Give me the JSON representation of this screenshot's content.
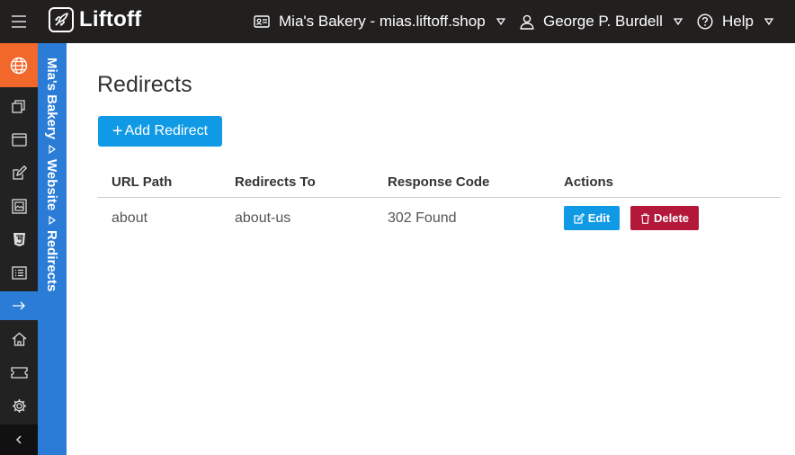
{
  "app": {
    "name": "Liftoff"
  },
  "topbar": {
    "site_label": "Mia's Bakery - mias.liftoff.shop",
    "user_label": "George P. Burdell",
    "help_label": "Help"
  },
  "rail": {
    "items": [
      {
        "icon": "globe-icon",
        "active": true
      },
      {
        "icon": "pages-icon"
      },
      {
        "icon": "window-icon"
      },
      {
        "icon": "edit-icon"
      },
      {
        "icon": "image-icon"
      },
      {
        "icon": "css-icon"
      },
      {
        "icon": "list-icon"
      },
      {
        "icon": "arrow-right-icon",
        "highlighted": true
      },
      {
        "icon": "home-icon"
      },
      {
        "icon": "ticket-icon"
      },
      {
        "icon": "gear-icon"
      },
      {
        "icon": "chevron-left-icon"
      }
    ],
    "colors": {
      "active": "#f2672a",
      "highlighted": "#2a7cd6",
      "bg": "#222222"
    }
  },
  "breadcrumbs": [
    "Mia's Bakery",
    "Website",
    "Redirects"
  ],
  "main": {
    "title": "Redirects",
    "add_button_label": "Add Redirect",
    "table": {
      "headers": [
        "URL Path",
        "Redirects To",
        "Response Code",
        "Actions"
      ],
      "rows": [
        {
          "url_path": "about",
          "redirects_to": "about-us",
          "response_code": "302 Found",
          "edit_label": "Edit",
          "delete_label": "Delete"
        }
      ]
    }
  },
  "colors": {
    "primary": "#109ae6",
    "danger": "#b3173a",
    "topbar": "#221f1f"
  }
}
